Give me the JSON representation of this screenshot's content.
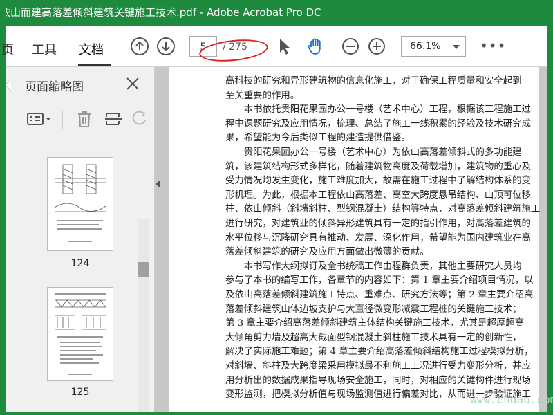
{
  "window": {
    "title": "依山而建高落差倾斜建筑关键施工技术.pdf - Adobe Acrobat Pro DC"
  },
  "toolbar": {
    "tabs": [
      {
        "label": "页"
      },
      {
        "label": "工具"
      },
      {
        "label": "文档"
      }
    ],
    "page_input": "5",
    "page_total": "/ 275",
    "zoom": "66.1%",
    "more": "•••"
  },
  "sidebar": {
    "title": "页面缩略图",
    "thumbnails": [
      {
        "page": "124"
      },
      {
        "page": "125"
      }
    ]
  },
  "document": {
    "lines": [
      "高科技的研究和异形建筑物的信息化施工，对于确保工程质量和安全起到",
      "至关重要的作用。",
      "　　本书依托贵阳花果园办公一号楼（艺术中心）工程，根据该工程施工过",
      "程中课题研究及应用情况，梳理、总结了施工一线积累的经验及技术研究成",
      "果，希望能为今后类似工程的建造提供借鉴。",
      "　　贵阳花果园办公一号楼（艺术中心）为依山高落差倾斜式的多功能建",
      "筑，该建筑结构形式多样化，随着建筑物高度及荷载增加，建筑物的重心及",
      "受力情况均发生变化，施工难度加大，故需在施工过程中了解结构体系的变",
      "形机理。为此，根据本工程依山高落差、高空大跨度悬吊结构、山顶可位移",
      "柱、依山倾斜（斜墙斜柱、型钢混凝土）结构等特点，对高落差倾斜建筑施工",
      "进行研究，对建筑业的倾斜异形建筑具有一定的指引作用，对高落差建筑的",
      "水平位移与沉降研究具有推动、发展、深化作用，希望能为国内建筑业在高",
      "落差倾斜建筑的研究及应用方面做出微薄的贡献。",
      "　　本书写作大纲拟订及全书统稿工作由程群负责，其他主要研究人员均",
      "参与了本书的编写工作，各章节的内容如下：第 1 章主要介绍项目情况，以",
      "及依山高落差倾斜建筑施工特点、重难点、研究方法等；第 2 章主要介绍高",
      "落差倾斜建筑山体边坡支护与大直径微变形减震工程桩的关键施工技术；",
      "第 3 章主要介绍高落差倾斜建筑主体结构关键施工技术，尤其是超厚超高",
      "大倾角剪力墙及超高大截面型钢混凝土斜柱施工技术具有一定的创新性，",
      "解决了实际施工难题；第 4 章主要介绍高落差倾斜结构施工过程模拟分析，",
      "对斜墙、斜柱及大跨度梁采用模拟最不利施工工况进行受力变形分析，并应",
      "用分析出的数据成果指导现场安全施工，同时，对相应的关键构件进行现场",
      "变形监测，把模拟分析值与现场监测值进行偏差对比，从而进一步验证施工"
    ]
  },
  "watermark": "www.cndao.com",
  "colors": {
    "titlebar": "#1e8a3d",
    "annotation": "#e02020"
  }
}
